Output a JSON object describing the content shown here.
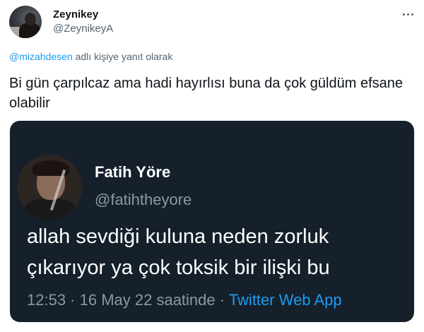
{
  "tweet": {
    "author_name": "Zeynikey",
    "author_handle": "@ZeynikeyA",
    "reply_mention": "@mizahdesen",
    "reply_suffix": " adlı kişiye yanıt olarak",
    "text": "Bi gün çarpılcaz ama hadi hayırlısı buna da çok güldüm efsane olabilir",
    "more_icon": "more-horizontal-icon"
  },
  "quoted_tweet": {
    "author_name": "Fatih Yöre",
    "author_handle": "@fatihtheyore",
    "text": "allah sevdiği kuluna neden zorluk çıkarıyor ya çok toksik bir ilişki bu",
    "time": "12:53",
    "date": "16 May 22 saatinde",
    "source": "Twitter Web App",
    "separator": " · "
  },
  "colors": {
    "link": "#1d9bf0",
    "secondary_text": "#536471",
    "quote_background": "#15202b",
    "quote_secondary": "#8b98a5"
  }
}
